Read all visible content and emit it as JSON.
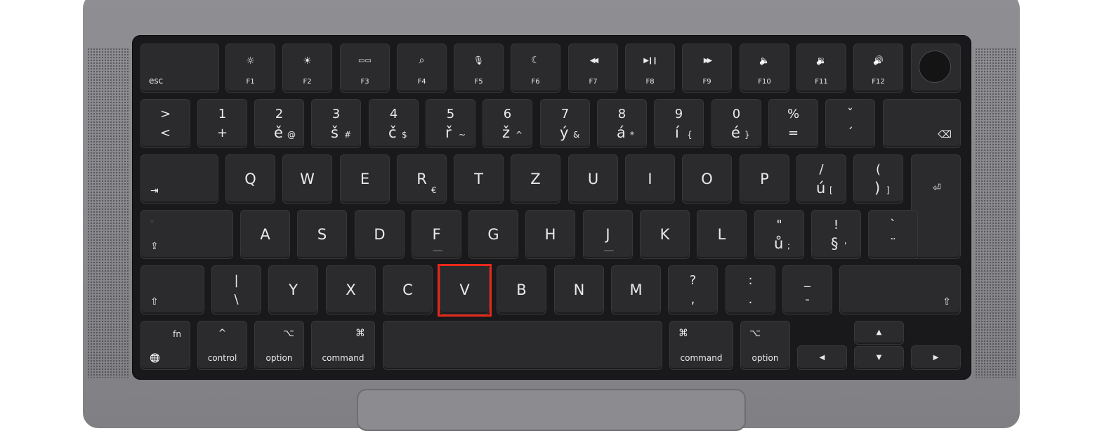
{
  "keyboard": {
    "esc": "esc",
    "f1": "F1",
    "f2": "F2",
    "f3": "F3",
    "f4": "F4",
    "f5": "F5",
    "f6": "F6",
    "f7": "F7",
    "f8": "F8",
    "f9": "F9",
    "f10": "F10",
    "f11": "F11",
    "f12": "F12",
    "n1": {
      "top": "1",
      "bottom": "+"
    },
    "n2": {
      "top": "2",
      "bottom": "ě",
      "alt": "@"
    },
    "n3": {
      "top": "3",
      "bottom": "š",
      "alt": "#"
    },
    "n4": {
      "top": "4",
      "bottom": "č",
      "alt": "$"
    },
    "n5": {
      "top": "5",
      "bottom": "ř",
      "alt": "~"
    },
    "n6": {
      "top": "6",
      "bottom": "ž",
      "alt": "^"
    },
    "n7": {
      "top": "7",
      "bottom": "ý",
      "alt": "&"
    },
    "n8": {
      "top": "8",
      "bottom": "á",
      "alt": "*"
    },
    "n9": {
      "top": "9",
      "bottom": "í",
      "alt": "{"
    },
    "n0": {
      "top": "0",
      "bottom": "é",
      "alt": "}"
    },
    "percent": {
      "top": "%",
      "bottom": "="
    },
    "caron": {
      "top": "ˇ",
      "bottom": "´"
    },
    "grave_key": {
      "top": ">",
      "bottom": "<"
    },
    "q": "Q",
    "w": "W",
    "e": "E",
    "r": "R",
    "r_alt": "€",
    "t": "T",
    "z": "Z",
    "u": "U",
    "i": "I",
    "o": "O",
    "p": "P",
    "uacute": {
      "top": "/",
      "bottom": "ú",
      "alt": "["
    },
    "paren": {
      "top": "(",
      "bottom": ")",
      "alt": "]"
    },
    "a": "A",
    "s": "S",
    "d": "D",
    "f": "F",
    "g": "G",
    "h": "H",
    "j": "J",
    "k": "K",
    "l": "L",
    "uring": {
      "top": "\"",
      "bottom": "ů",
      "alt": ";"
    },
    "section": {
      "top": "!",
      "bottom": "§",
      "alt": "'"
    },
    "backtick": {
      "top": "`",
      "bottom": "¨"
    },
    "pipe": {
      "top": "|",
      "bottom": "\\"
    },
    "y": "Y",
    "x": "X",
    "c": "C",
    "v": "V",
    "b": "B",
    "n": "N",
    "m": "M",
    "question": {
      "top": "?",
      "bottom": ","
    },
    "colon": {
      "top": ":",
      "bottom": "."
    },
    "underscore": {
      "top": "_",
      "bottom": "-"
    },
    "fn": "fn",
    "control": "control",
    "option_left": "option",
    "command_left": "command",
    "command_right": "command",
    "option_right": "option"
  },
  "icons": {
    "brightness_down": "☼",
    "brightness_up": "☀",
    "mission_control": "▭▭",
    "search": "⌕",
    "dictation": "🎙",
    "moon": "☾",
    "rewind": "◀◀",
    "play_pause": "▶❙❙",
    "fast_forward": "▶▶",
    "mute": "🔈",
    "vol_down": "🔉",
    "vol_up": "🔊",
    "delete": "⌫",
    "tab": "⇥",
    "return": "⏎",
    "caps": "⇪",
    "shift": "⇧",
    "globe": "🌐",
    "control": "^",
    "option": "⌥",
    "command": "⌘",
    "arrow_up": "▲",
    "arrow_down": "▼",
    "arrow_left": "◀",
    "arrow_right": "▶"
  },
  "highlight": {
    "key": "V",
    "color": "#e8281a"
  }
}
